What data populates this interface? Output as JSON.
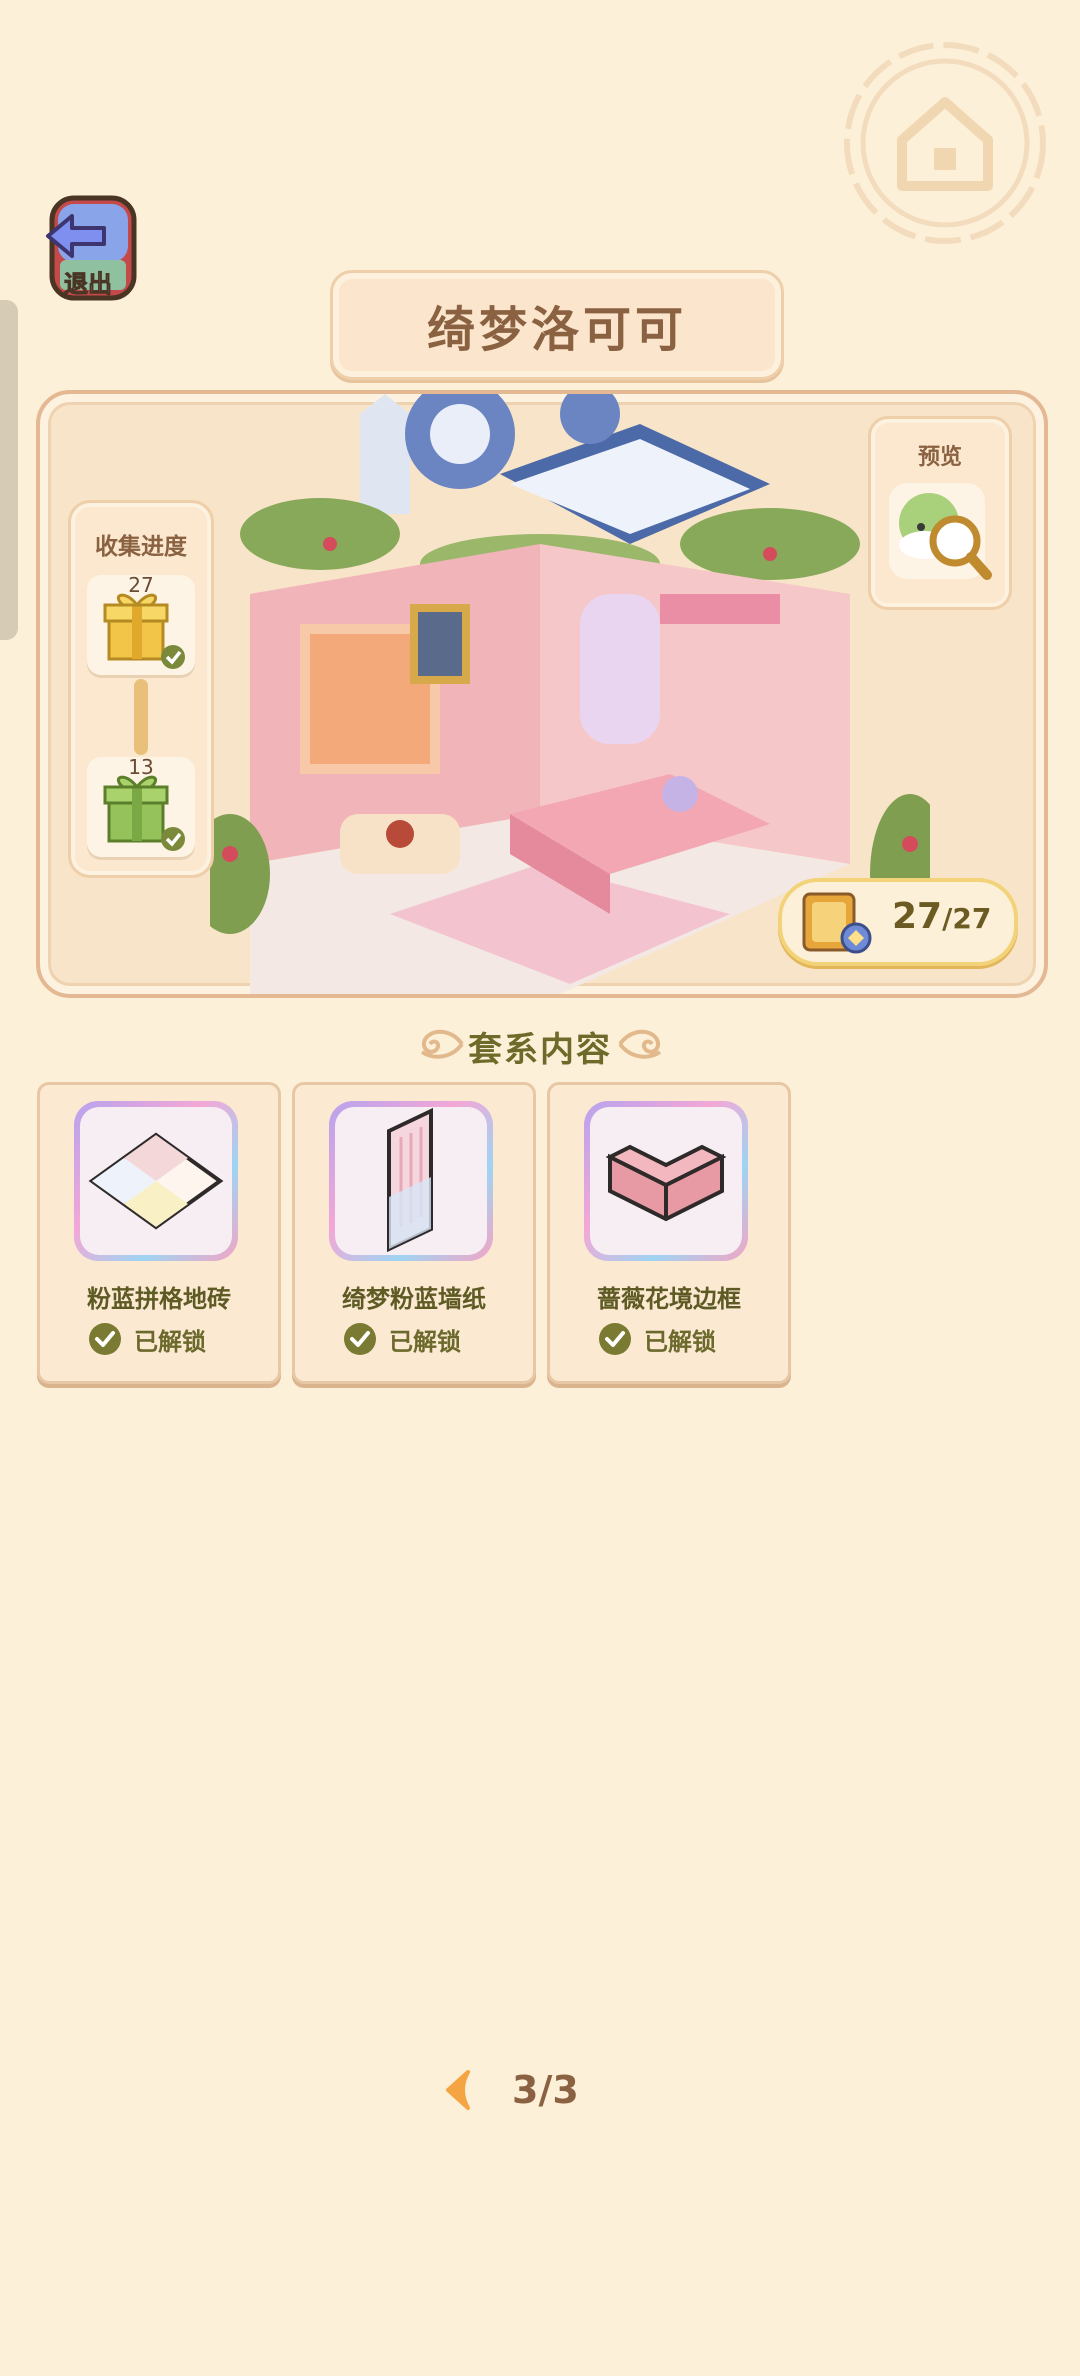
{
  "header": {
    "exit_label": "退出",
    "title": "绮梦洛可可"
  },
  "collection_progress": {
    "title": "收集进度",
    "rewards": [
      {
        "count": "27",
        "icon": "gold-gift-icon",
        "claimed": true
      },
      {
        "count": "13",
        "icon": "green-gift-icon",
        "claimed": true
      }
    ]
  },
  "preview": {
    "label": "预览",
    "icon": "magnifier-preview-icon"
  },
  "counter": {
    "value": "27",
    "total": "/27",
    "icon": "furniture-book-icon"
  },
  "section": {
    "title": "套系内容"
  },
  "items": [
    {
      "name": "粉蓝拼格地砖",
      "status": "已解锁",
      "icon": "floor-tile-icon"
    },
    {
      "name": "绮梦粉蓝墙纸",
      "status": "已解锁",
      "icon": "wallpaper-icon"
    },
    {
      "name": "蔷薇花境边框",
      "status": "已解锁",
      "icon": "border-frame-icon"
    }
  ],
  "pagination": {
    "text": "3/3"
  },
  "colors": {
    "background": "#fdf0d8",
    "panel_border": "#e3b892",
    "status_green": "#7a7a32",
    "accent_orange": "#f5a443"
  }
}
